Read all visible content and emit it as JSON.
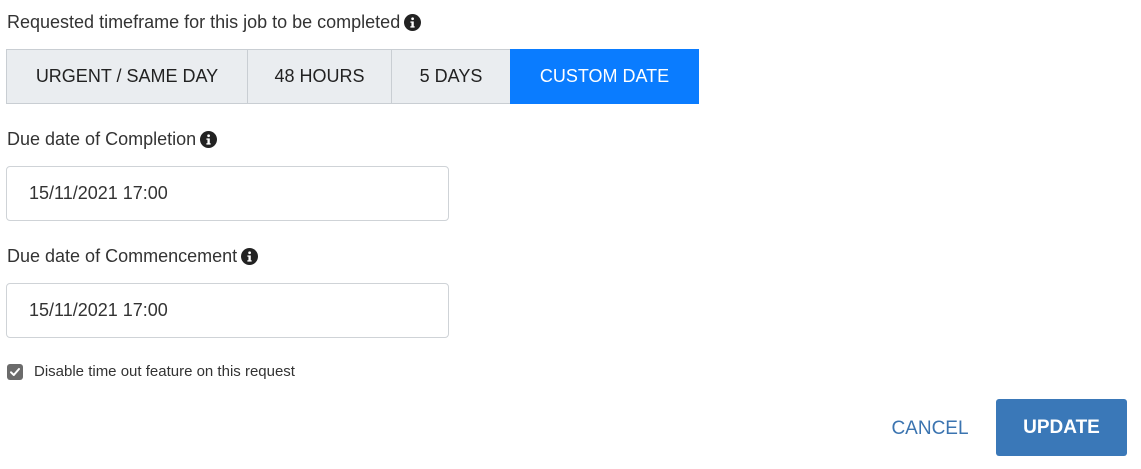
{
  "timeframe": {
    "label": "Requested timeframe for this job to be completed",
    "options": [
      {
        "label": "URGENT / SAME DAY"
      },
      {
        "label": "48 HOURS"
      },
      {
        "label": "5 DAYS"
      },
      {
        "label": "CUSTOM DATE"
      }
    ],
    "selected": "CUSTOM DATE",
    "active_color": "#0a7cff",
    "inactive_color": "#eaedf0"
  },
  "completion": {
    "label": "Due date of Completion",
    "value": "15/11/2021 17:00"
  },
  "commencement": {
    "label": "Due date of Commencement",
    "value": "15/11/2021 17:00"
  },
  "timeout": {
    "label": "Disable time out feature on this request",
    "checked": true
  },
  "actions": {
    "cancel_label": "CANCEL",
    "update_label": "UPDATE",
    "primary_color": "#3a78b8"
  },
  "icons": {
    "info": "info-circle-icon",
    "check": "checkmark-icon"
  }
}
